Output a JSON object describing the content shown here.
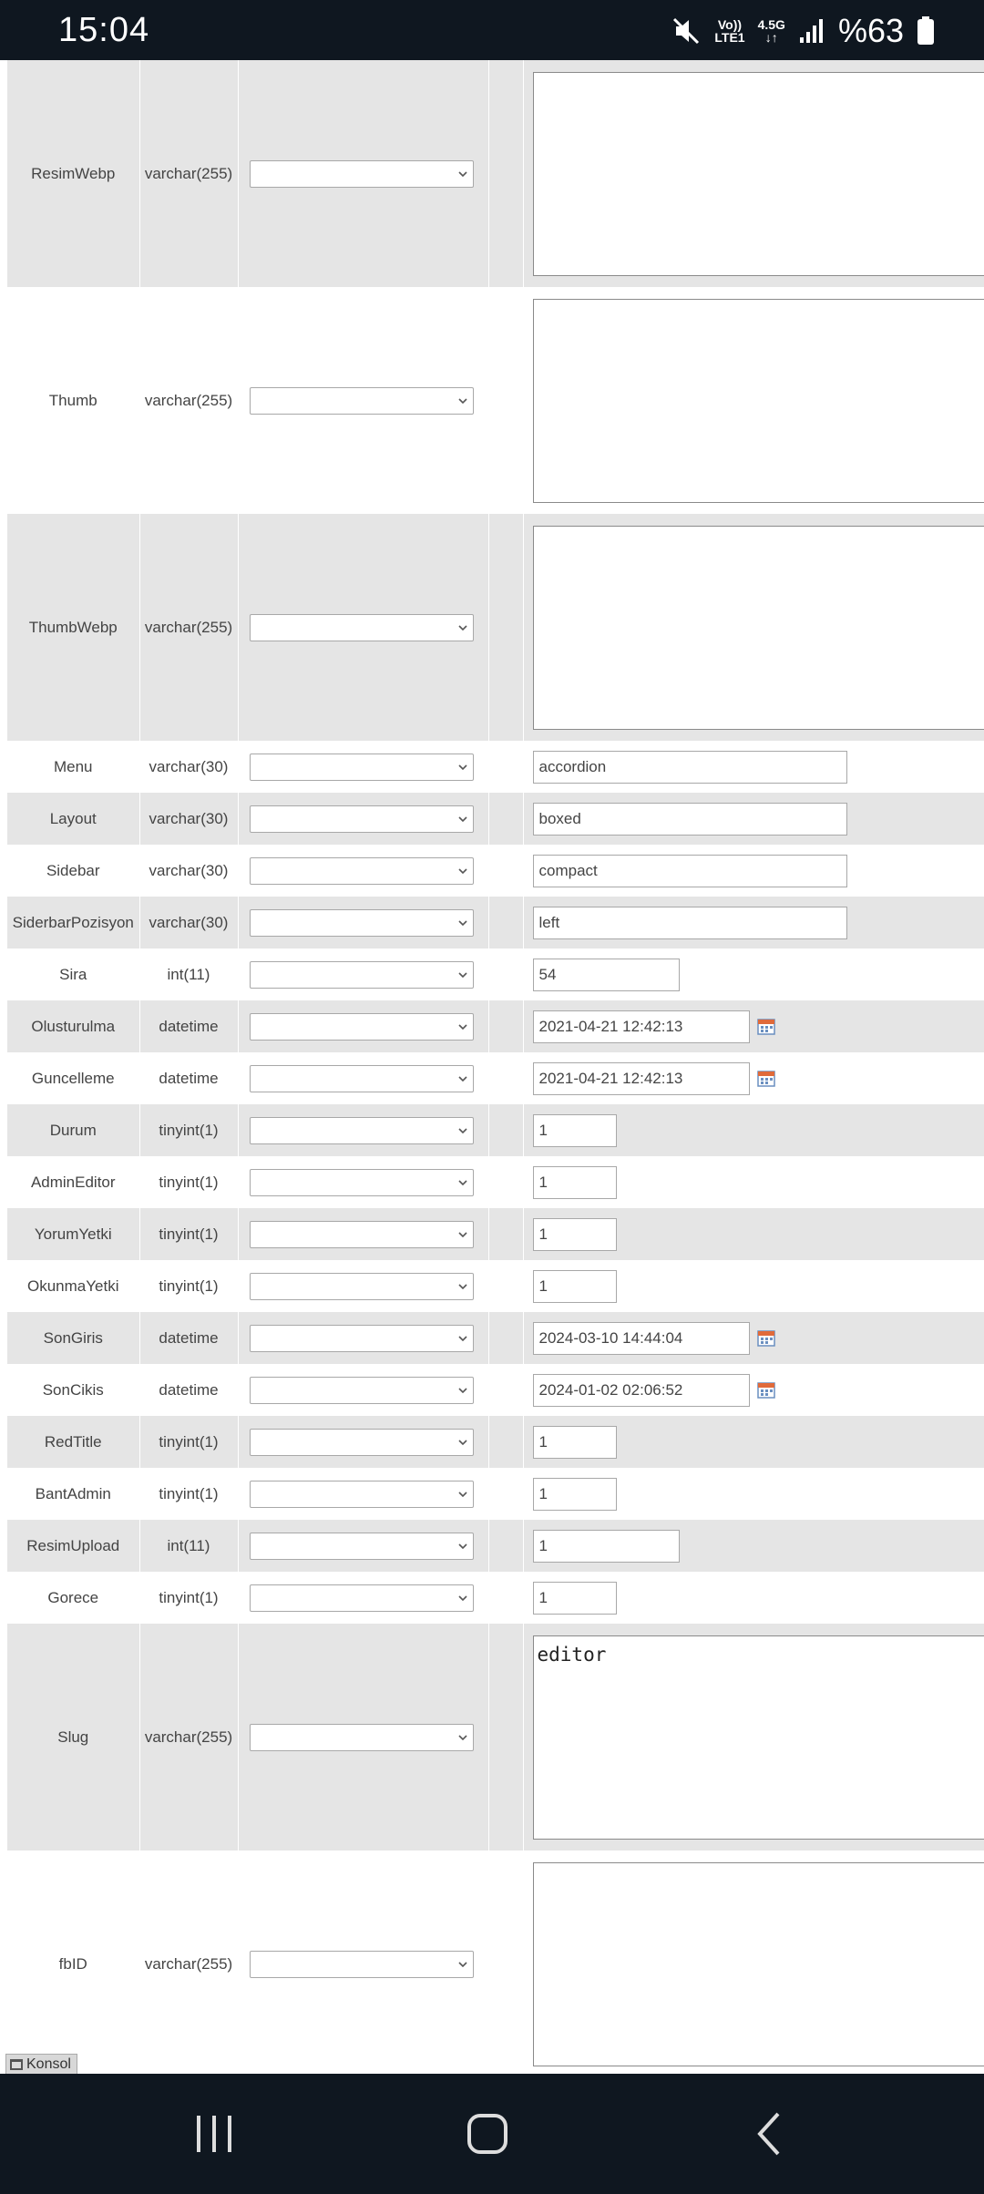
{
  "status_bar": {
    "time": "15:04",
    "network_top": "Vo))",
    "network_bottom": "LTE1",
    "network_type": "4.5G",
    "battery": "%63"
  },
  "rows": [
    {
      "name": "ResimWebp",
      "type": "varchar(255)",
      "value": "",
      "input": "textarea"
    },
    {
      "name": "Thumb",
      "type": "varchar(255)",
      "value": "",
      "input": "textarea"
    },
    {
      "name": "ThumbWebp",
      "type": "varchar(255)",
      "value": "",
      "input": "textarea"
    },
    {
      "name": "Menu",
      "type": "varchar(30)",
      "value": "accordion",
      "input": "text-wide"
    },
    {
      "name": "Layout",
      "type": "varchar(30)",
      "value": "boxed",
      "input": "text-wide"
    },
    {
      "name": "Sidebar",
      "type": "varchar(30)",
      "value": "compact",
      "input": "text-wide"
    },
    {
      "name": "SiderbarPozisyon",
      "type": "varchar(30)",
      "value": "left",
      "input": "text-wide"
    },
    {
      "name": "Sira",
      "type": "int(11)",
      "value": "54",
      "input": "text-mid"
    },
    {
      "name": "Olusturulma",
      "type": "datetime",
      "value": "2021-04-21 12:42:13",
      "input": "datetime"
    },
    {
      "name": "Guncelleme",
      "type": "datetime",
      "value": "2021-04-21 12:42:13",
      "input": "datetime"
    },
    {
      "name": "Durum",
      "type": "tinyint(1)",
      "value": "1",
      "input": "text-small"
    },
    {
      "name": "AdminEditor",
      "type": "tinyint(1)",
      "value": "1",
      "input": "text-small"
    },
    {
      "name": "YorumYetki",
      "type": "tinyint(1)",
      "value": "1",
      "input": "text-small"
    },
    {
      "name": "OkunmaYetki",
      "type": "tinyint(1)",
      "value": "1",
      "input": "text-small"
    },
    {
      "name": "SonGiris",
      "type": "datetime",
      "value": "2024-03-10 14:44:04",
      "input": "datetime"
    },
    {
      "name": "SonCikis",
      "type": "datetime",
      "value": "2024-01-02 02:06:52",
      "input": "datetime"
    },
    {
      "name": "RedTitle",
      "type": "tinyint(1)",
      "value": "1",
      "input": "text-small"
    },
    {
      "name": "BantAdmin",
      "type": "tinyint(1)",
      "value": "1",
      "input": "text-small"
    },
    {
      "name": "ResimUpload",
      "type": "int(11)",
      "value": "1",
      "input": "text-mid"
    },
    {
      "name": "Gorece",
      "type": "tinyint(1)",
      "value": "1",
      "input": "text-small"
    },
    {
      "name": "Slug",
      "type": "varchar(255)",
      "value": "editor",
      "input": "textarea"
    },
    {
      "name": "fbID",
      "type": "varchar(255)",
      "value": "",
      "input": "textarea"
    }
  ],
  "console_label": "Konsol"
}
